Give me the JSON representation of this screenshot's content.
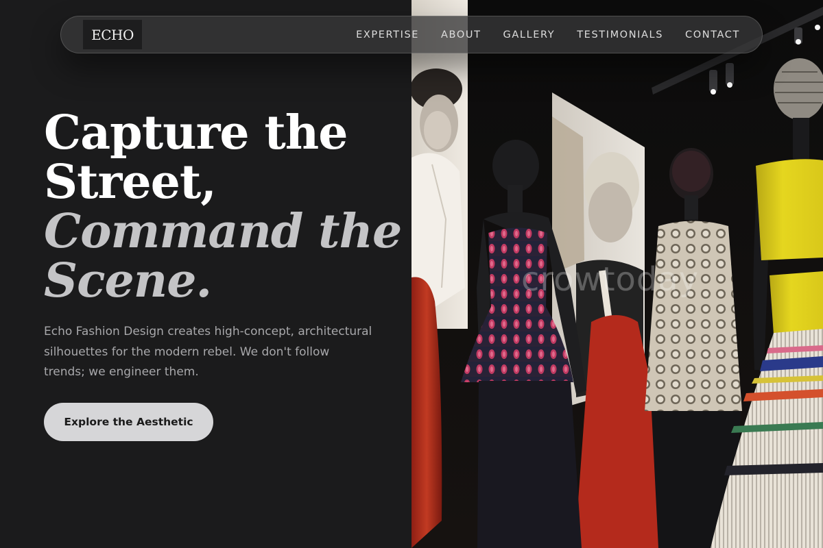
{
  "brand": {
    "logo_text": "ECHO"
  },
  "nav": {
    "links": [
      "EXPERTISE",
      "ABOUT",
      "GALLERY",
      "TESTIMONIALS",
      "CONTACT"
    ]
  },
  "hero": {
    "title_line1": "Capture the",
    "title_line2": "Street,",
    "title_line3": "Command the",
    "title_line4": "Scene.",
    "description": "Echo Fashion Design creates high-concept, architectural silhouettes for the modern rebel. We don't follow trends; we engineer them.",
    "cta_label": "Explore the Aesthetic"
  },
  "image": {
    "subject": "fashion-exhibition-mannequins",
    "watermark": "crowtoday"
  },
  "colors": {
    "background": "#1b1b1c",
    "title_white": "#ffffff",
    "title_italic": "#c4c4c6",
    "body_text": "#a8a8ab",
    "button_bg": "#d6d6d8",
    "accent_yellow": "#e3d51e",
    "accent_red": "#b8321e"
  }
}
